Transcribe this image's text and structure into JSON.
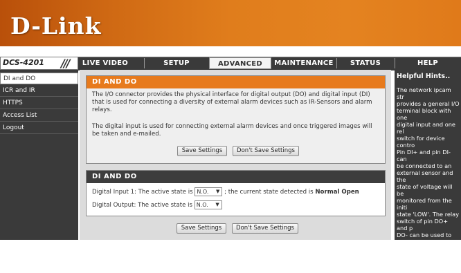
{
  "brand": {
    "logo_text": "D-Link"
  },
  "header": {
    "model": "DCS-4201",
    "slashes": "///"
  },
  "tabs": [
    {
      "label": "LIVE VIDEO"
    },
    {
      "label": "SETUP"
    },
    {
      "label": "ADVANCED",
      "active": true
    },
    {
      "label": "MAINTENANCE"
    },
    {
      "label": "STATUS"
    },
    {
      "label": "HELP"
    }
  ],
  "sidebar": {
    "items": [
      {
        "label": "DI and DO",
        "active": true
      },
      {
        "label": "ICR and IR"
      },
      {
        "label": "HTTPS"
      },
      {
        "label": "Access List"
      },
      {
        "label": "Logout"
      }
    ]
  },
  "section1": {
    "title": "DI AND DO",
    "para1": "The I/O connector provides the physical interface for digital output (DO) and digital input (DI) that is used for connecting a diversity of external alarm devices such as IR-Sensors and alarm relays.",
    "para2": "The digital input is used for connecting external alarm devices and once triggered images will be taken and e-mailed.",
    "save_label": "Save Settings",
    "dont_save_label": "Don't Save Settings"
  },
  "section2": {
    "title": "DI AND DO",
    "di_label": "Digital Input 1: The active state is",
    "di_value": "N.O.",
    "di_state_prefix": "; the current state detected is",
    "di_state": "Normal Open",
    "do_label": "Digital Output: The active state is",
    "do_value": "N.O."
  },
  "bottom": {
    "save_label": "Save Settings",
    "dont_save_label": "Don't Save Settings"
  },
  "hints": {
    "title": "Helpful Hints..",
    "text": "The network ipcam str\nprovides a general I/O\nterminal block with one\ndigital input and one rel\nswitch for device contro\nPin DI+ and pin DI- can\nbe connected to an\nexternal sensor and the\nstate of voltage will be\nmonitored from the initi\nstate 'LOW'. The relay\nswitch of pin DO+ and p\nDO- can be used to turn\non or off the external\ndevice. Please refer to\nmanual for detail\nconnection diagram."
  },
  "colors": {
    "accent": "#e77a1c",
    "nav_dark": "#3a3a3a",
    "content_bg": "#dcdcdc"
  }
}
